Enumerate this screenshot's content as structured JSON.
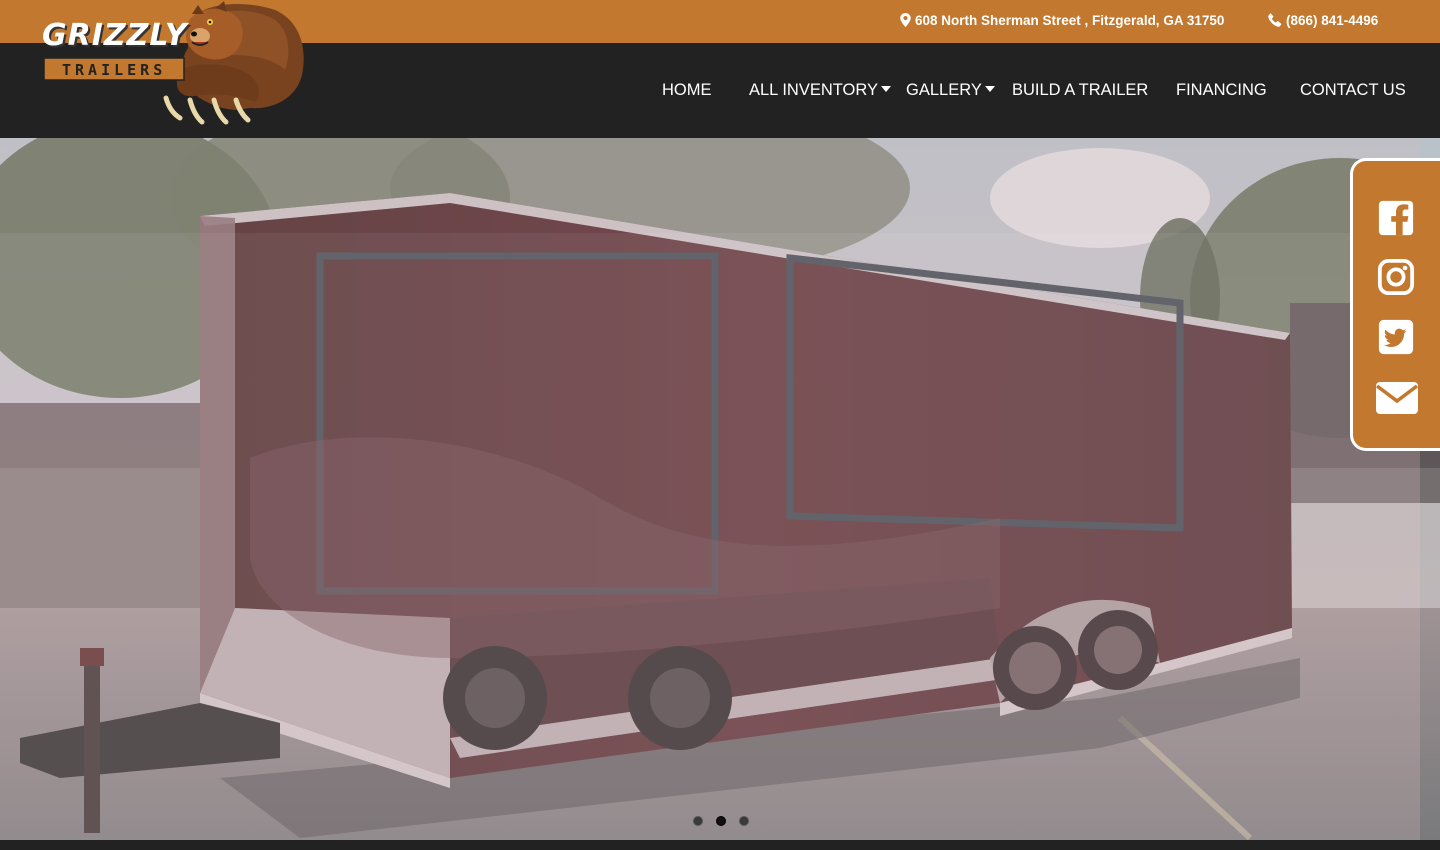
{
  "brand": {
    "name": "GRIZZLY",
    "tagline": "TRAILERS",
    "accent_color": "#c2782e",
    "nav_bg": "#222222"
  },
  "topbar": {
    "address": "608 North Sherman Street , Fitzgerald, GA 31750",
    "phone": "(866) 841-4496",
    "address_icon": "map-pin-icon",
    "phone_icon": "phone-icon"
  },
  "nav": {
    "items": [
      {
        "label": "HOME",
        "dropdown": false
      },
      {
        "label": "ALL INVENTORY",
        "dropdown": true
      },
      {
        "label": "GALLERY",
        "dropdown": true
      },
      {
        "label": "BUILD A TRAILER",
        "dropdown": false
      },
      {
        "label": "FINANCING",
        "dropdown": false
      },
      {
        "label": "CONTACT US",
        "dropdown": false
      }
    ]
  },
  "social": {
    "icons": [
      "facebook-icon",
      "instagram-icon",
      "twitter-icon",
      "envelope-icon"
    ]
  },
  "slider": {
    "total_slides": 3,
    "active_slide": 2
  }
}
